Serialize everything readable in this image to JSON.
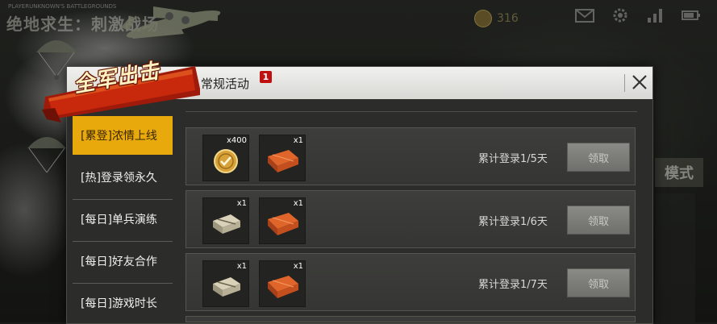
{
  "background": {
    "game_title": "绝地求生：刺激战场",
    "game_subtitle": "PLAYERUNKNOWN'S BATTLEGROUNDS",
    "currency": "316",
    "side_mode_label": "模式"
  },
  "banner": {
    "text": "全军出击"
  },
  "dialog": {
    "title": "常规活动",
    "badge": "1",
    "close_icon": "close-icon"
  },
  "sidebar": {
    "items": [
      {
        "label": "[累登]浓情上线",
        "active": true
      },
      {
        "label": "[热]登录领永久",
        "active": false
      },
      {
        "label": "[每日]单兵演练",
        "active": false
      },
      {
        "label": "[每日]好友合作",
        "active": false
      },
      {
        "label": "[每日]游戏时长",
        "active": false
      }
    ]
  },
  "rows": [
    {
      "items": [
        {
          "icon": "coin-icon",
          "qty": "x400"
        },
        {
          "icon": "crate-icon",
          "qty": "x1"
        }
      ],
      "desc": "累计登录1/5天",
      "button": "领取"
    },
    {
      "items": [
        {
          "icon": "supply-box-icon",
          "qty": "x1"
        },
        {
          "icon": "crate-icon",
          "qty": "x1"
        }
      ],
      "desc": "累计登录1/6天",
      "button": "领取"
    },
    {
      "items": [
        {
          "icon": "supply-box-icon",
          "qty": "x1"
        },
        {
          "icon": "crate-icon",
          "qty": "x1"
        }
      ],
      "desc": "累计登录1/7天",
      "button": "领取"
    }
  ],
  "colors": {
    "active_tab": "#e8a90d",
    "badge": "#c01010",
    "claim_button": "#7d7e7a"
  }
}
